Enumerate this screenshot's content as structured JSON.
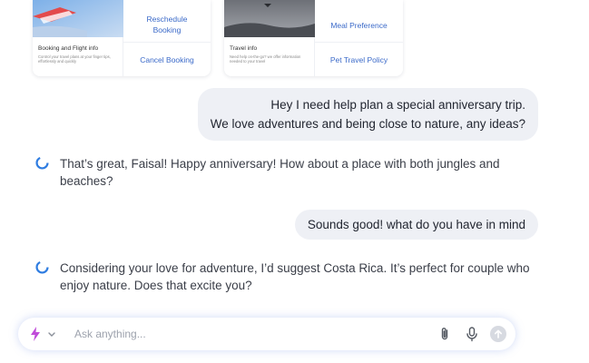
{
  "cards": [
    {
      "title": "Booking and Flight info",
      "description": "Control your travel plans at your finger tips, effortlessly and quickly",
      "links": [
        "Reschedule Booking",
        "Cancel Booking"
      ],
      "image_icon": "airplane-image"
    },
    {
      "title": "Travel info",
      "description": "Need help on-the-go? we offer information needed to your travel",
      "links": [
        "Meal Preference",
        "Pet Travel Policy"
      ],
      "image_icon": "travel-image"
    }
  ],
  "messages": [
    {
      "role": "user",
      "lines": [
        "Hey I need help plan a special anniversary trip.",
        "We love adventures and being close to nature, any ideas?"
      ]
    },
    {
      "role": "assistant",
      "text": "That’s great, Faisal! Happy anniversary! How about a place with both jungles and beaches?"
    },
    {
      "role": "user",
      "lines": [
        "Sounds good! what do you have in mind"
      ]
    },
    {
      "role": "assistant",
      "text": "Considering your love for adventure, I’d suggest Costa Rica. It’s perfect for couple who enjoy nature. Does that excite you?"
    }
  ],
  "composer": {
    "placeholder": "Ask anything...",
    "icons": [
      "sparkle-icon",
      "chevron-down-icon",
      "paperclip-icon",
      "microphone-icon",
      "send-arrow-icon"
    ]
  },
  "colors": {
    "accent": "#3b6ac9",
    "bubble": "#eef0f5",
    "sparkle": "#c04bd9"
  }
}
